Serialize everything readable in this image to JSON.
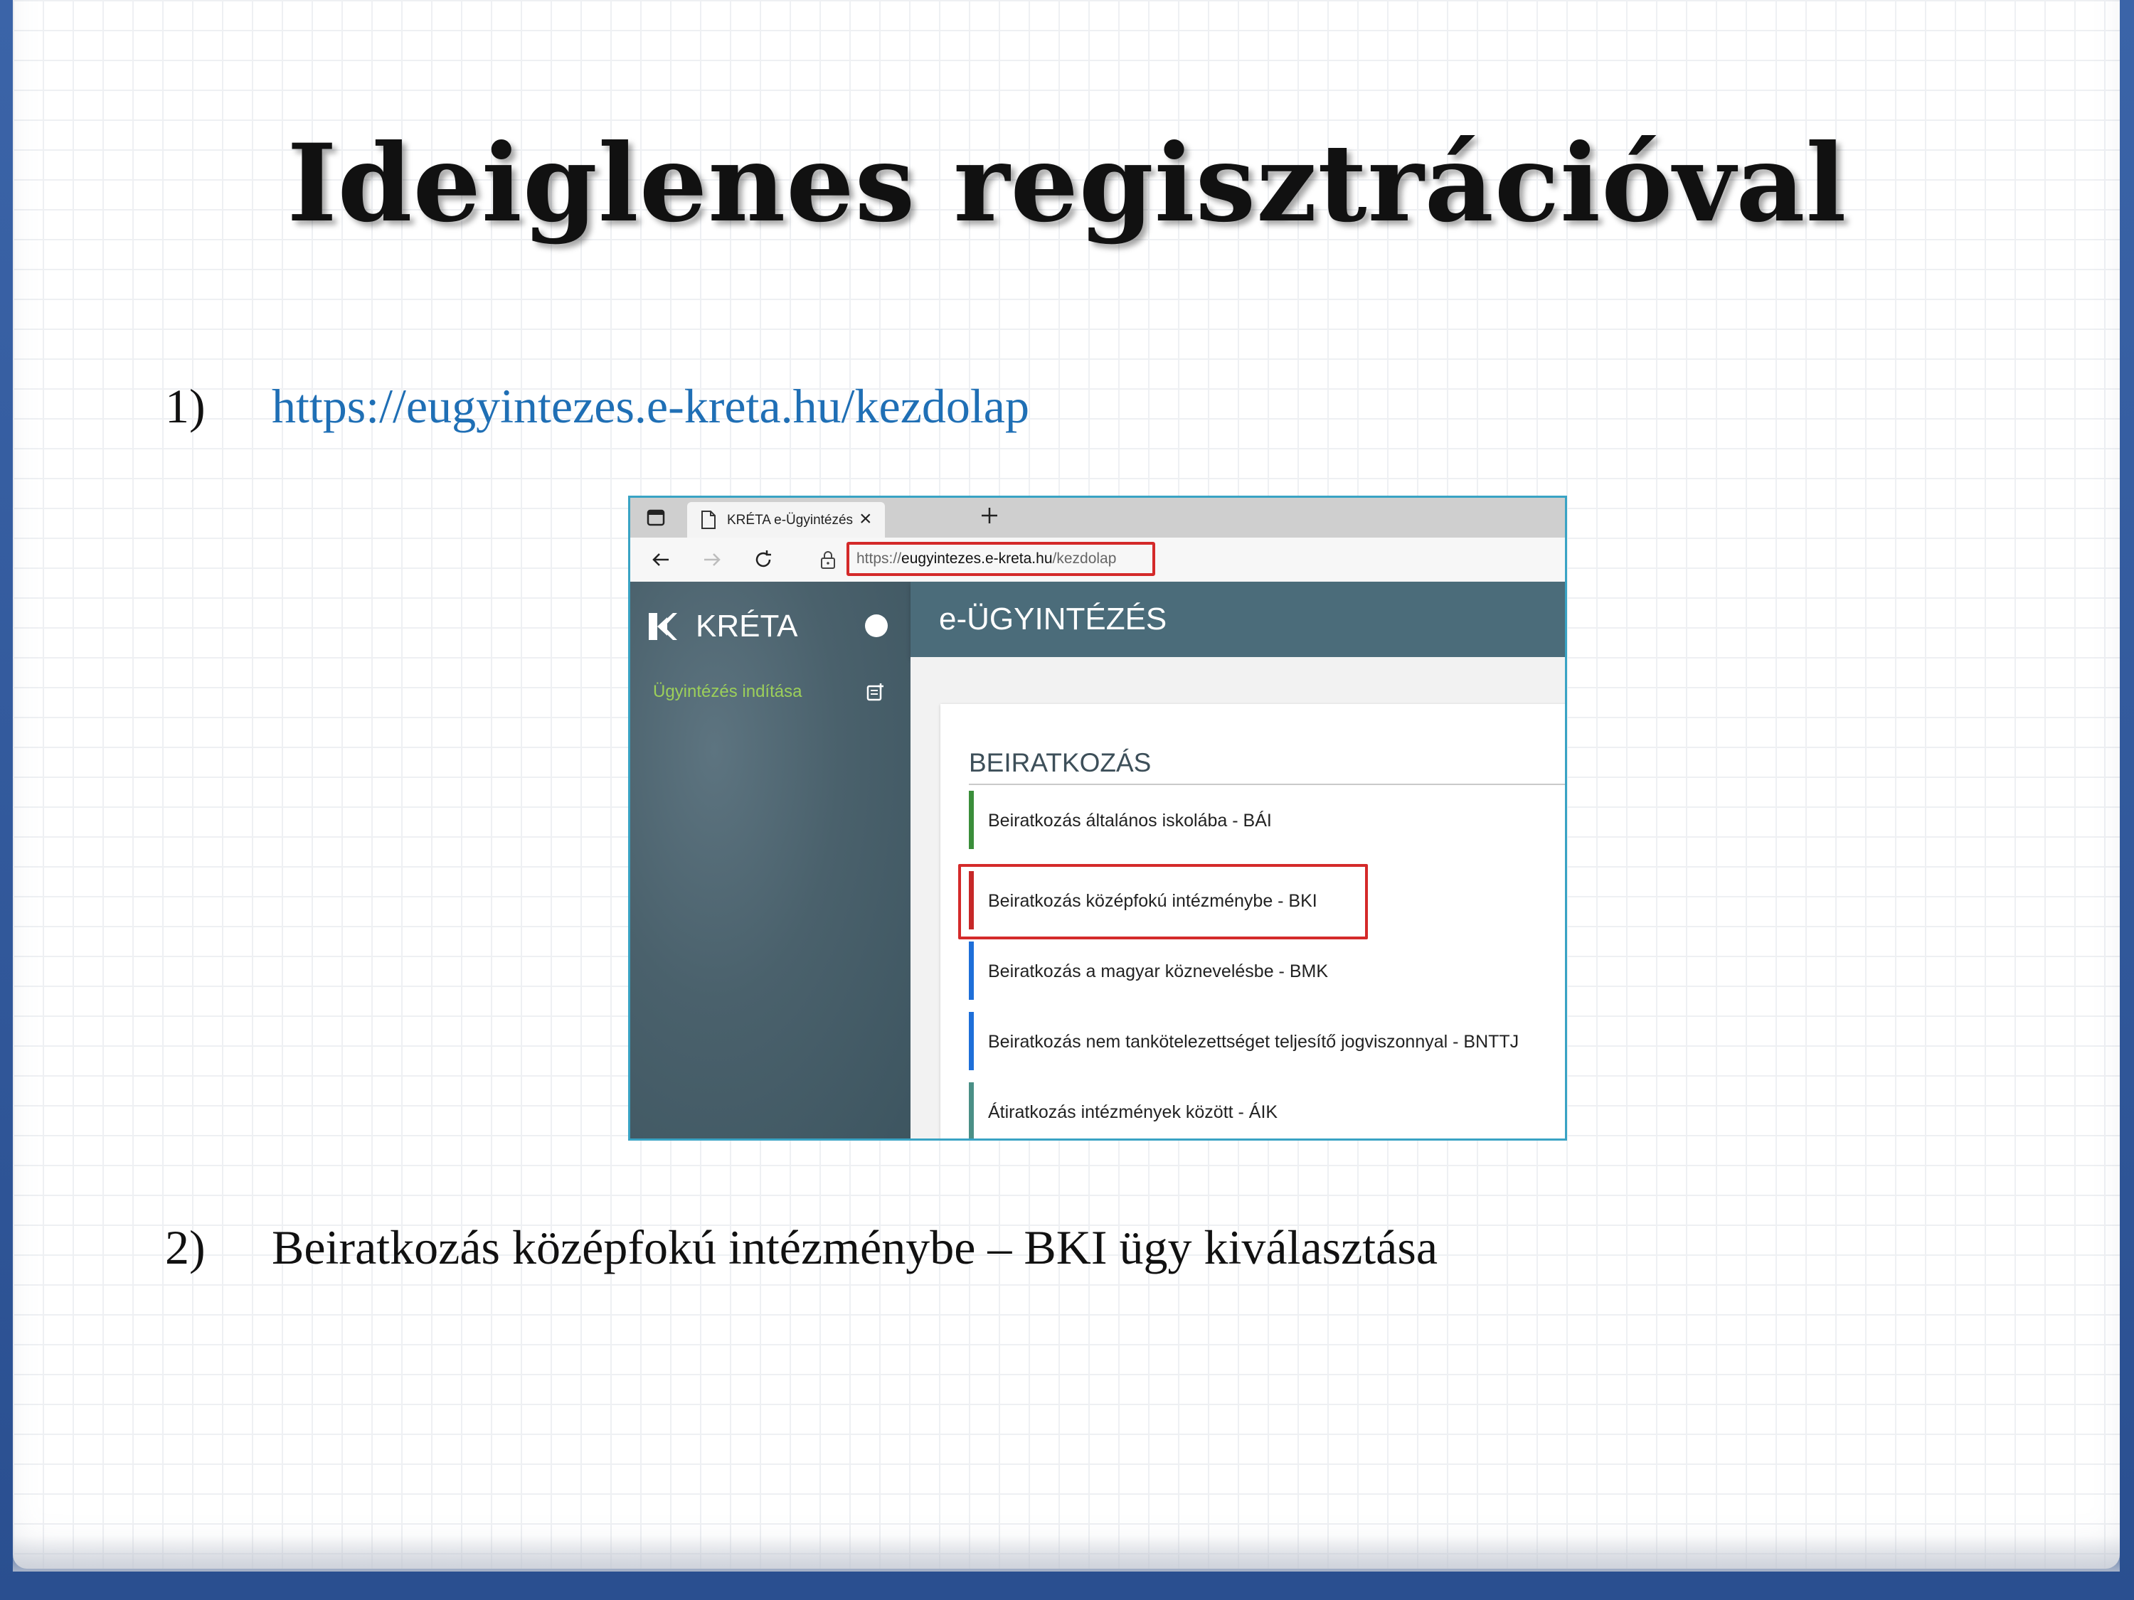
{
  "slide": {
    "title": "Ideiglenes regisztrációval",
    "steps": [
      {
        "number": "1)",
        "text": "https://eugyintezes.e-kreta.hu/kezdolap"
      },
      {
        "number": "2)",
        "text": "Beiratkozás középfokú intézménybe – BKI ügy kiválasztása"
      }
    ]
  },
  "browser": {
    "tab_title": "KRÉTA e-Ügyintézés",
    "tab_close": "×",
    "address_scheme": "https://",
    "address_domain": "eugyintezes.e-kreta.hu",
    "address_path": "/kezdolap"
  },
  "app": {
    "brand": "KRÉTA",
    "sidebar_link": "Ügyintézés indítása",
    "header_title": "e-ÜGYINTÉZÉS",
    "section_title": "BEIRATKOZÁS",
    "services": [
      {
        "label": "Beiratkozás általános iskolába - BÁI",
        "color": "#3a8e3a"
      },
      {
        "label": "Beiratkozás középfokú intézménybe - BKI",
        "color": "#c62828"
      },
      {
        "label": "Beiratkozás a magyar köznevelésbe - BMK",
        "color": "#1e6fd9"
      },
      {
        "label": "Beiratkozás nem tankötelezettséget teljesítő jogviszonnyal - BNTTJ",
        "color": "#1e6fd9"
      },
      {
        "label": "Átiratkozás intézmények között - ÁIK",
        "color": "#4a8f86"
      }
    ]
  },
  "colors": {
    "link": "#1f6fb5",
    "highlight": "#d42a2a",
    "app_header": "#4b6c7a",
    "sidebar": "#4a616c"
  }
}
